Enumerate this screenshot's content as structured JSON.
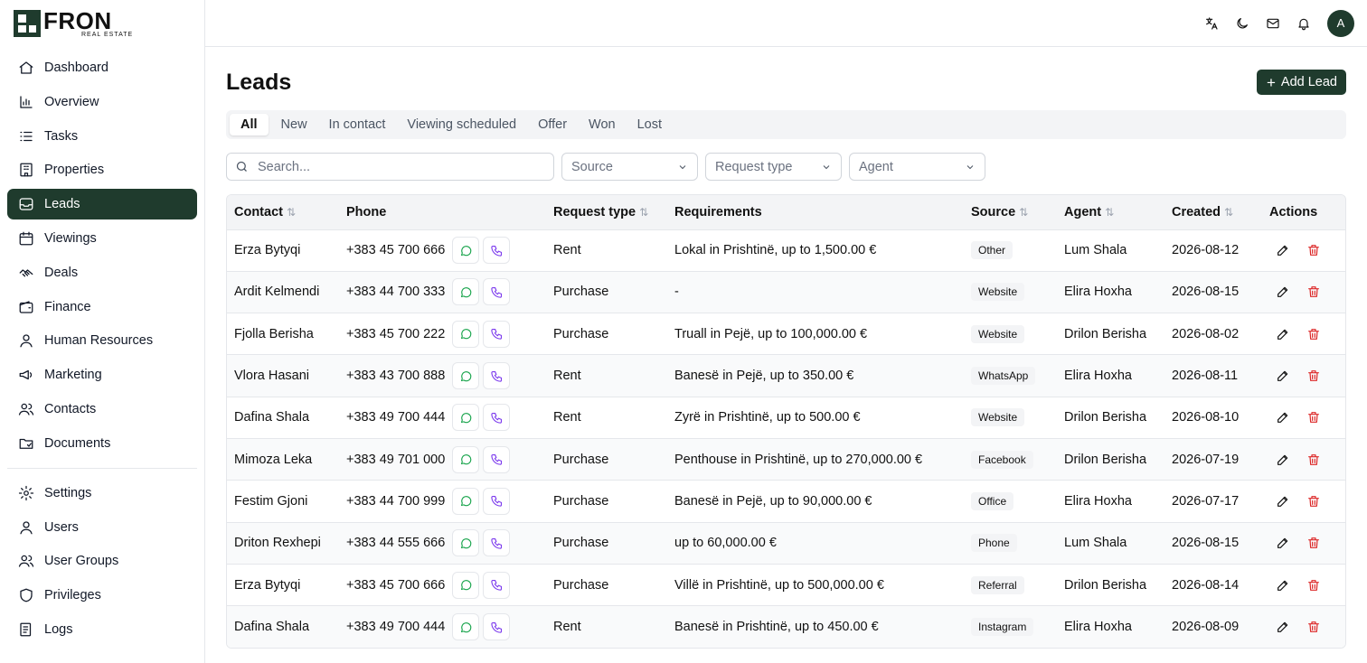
{
  "brand": {
    "name": "FRON",
    "tagline": "REAL ESTATE"
  },
  "sidebar": {
    "items": [
      {
        "label": "Dashboard",
        "icon": "home-icon"
      },
      {
        "label": "Overview",
        "icon": "chart-icon"
      },
      {
        "label": "Tasks",
        "icon": "list-icon"
      },
      {
        "label": "Properties",
        "icon": "building-icon"
      },
      {
        "label": "Leads",
        "icon": "inbox-icon",
        "active": true
      },
      {
        "label": "Viewings",
        "icon": "calendar-icon"
      },
      {
        "label": "Deals",
        "icon": "handshake-icon"
      },
      {
        "label": "Finance",
        "icon": "wallet-icon"
      },
      {
        "label": "Human Resources",
        "icon": "user-icon"
      },
      {
        "label": "Marketing",
        "icon": "megaphone-icon"
      },
      {
        "label": "Contacts",
        "icon": "users-icon"
      },
      {
        "label": "Documents",
        "icon": "folder-icon"
      }
    ],
    "bottom_items": [
      {
        "label": "Settings",
        "icon": "gear-icon"
      },
      {
        "label": "Users",
        "icon": "user-icon"
      },
      {
        "label": "User Groups",
        "icon": "users-icon"
      },
      {
        "label": "Privileges",
        "icon": "shield-icon"
      },
      {
        "label": "Logs",
        "icon": "logs-icon"
      }
    ]
  },
  "topbar": {
    "avatar_initial": "A"
  },
  "page": {
    "title": "Leads",
    "add_button": "Add Lead"
  },
  "tabs": [
    {
      "label": "All",
      "active": true
    },
    {
      "label": "New"
    },
    {
      "label": "In contact"
    },
    {
      "label": "Viewing scheduled"
    },
    {
      "label": "Offer"
    },
    {
      "label": "Won"
    },
    {
      "label": "Lost"
    }
  ],
  "filters": {
    "search_placeholder": "Search...",
    "source": "Source",
    "request_type": "Request type",
    "agent": "Agent"
  },
  "table": {
    "columns": {
      "contact": "Contact",
      "phone": "Phone",
      "request_type": "Request type",
      "requirements": "Requirements",
      "source": "Source",
      "agent": "Agent",
      "created": "Created",
      "actions": "Actions"
    },
    "rows": [
      {
        "contact": "Erza Bytyqi",
        "phone": "+383 45 700 666",
        "request_type": "Rent",
        "requirements": "Lokal in Prishtinë, up to 1,500.00 €",
        "source": "Other",
        "agent": "Lum Shala",
        "created": "2026-08-12"
      },
      {
        "contact": "Ardit Kelmendi",
        "phone": "+383 44 700 333",
        "request_type": "Purchase",
        "requirements": "-",
        "source": "Website",
        "agent": "Elira Hoxha",
        "created": "2026-08-15"
      },
      {
        "contact": "Fjolla Berisha",
        "phone": "+383 45 700 222",
        "request_type": "Purchase",
        "requirements": "Truall in Pejë, up to 100,000.00 €",
        "source": "Website",
        "agent": "Drilon Berisha",
        "created": "2026-08-02"
      },
      {
        "contact": "Vlora Hasani",
        "phone": "+383 43 700 888",
        "request_type": "Rent",
        "requirements": "Banesë in Pejë, up to 350.00 €",
        "source": "WhatsApp",
        "agent": "Elira Hoxha",
        "created": "2026-08-11"
      },
      {
        "contact": "Dafina Shala",
        "phone": "+383 49 700 444",
        "request_type": "Rent",
        "requirements": "Zyrë in Prishtinë, up to 500.00 €",
        "source": "Website",
        "agent": "Drilon Berisha",
        "created": "2026-08-10"
      },
      {
        "contact": "Mimoza Leka",
        "phone": "+383 49 701 000",
        "request_type": "Purchase",
        "requirements": "Penthouse in Prishtinë, up to 270,000.00 €",
        "source": "Facebook",
        "agent": "Drilon Berisha",
        "created": "2026-07-19"
      },
      {
        "contact": "Festim Gjoni",
        "phone": "+383 44 700 999",
        "request_type": "Purchase",
        "requirements": "Banesë in Pejë, up to 90,000.00 €",
        "source": "Office",
        "agent": "Elira Hoxha",
        "created": "2026-07-17"
      },
      {
        "contact": "Driton Rexhepi",
        "phone": "+383 44 555 666",
        "request_type": "Purchase",
        "requirements": "up to 60,000.00 €",
        "source": "Phone",
        "agent": "Lum Shala",
        "created": "2026-08-15"
      },
      {
        "contact": "Erza Bytyqi",
        "phone": "+383 45 700 666",
        "request_type": "Purchase",
        "requirements": "Villë in Prishtinë, up to 500,000.00 €",
        "source": "Referral",
        "agent": "Drilon Berisha",
        "created": "2026-08-14"
      },
      {
        "contact": "Dafina Shala",
        "phone": "+383 49 700 444",
        "request_type": "Rent",
        "requirements": "Banesë in Prishtinë, up to 450.00 €",
        "source": "Instagram",
        "agent": "Elira Hoxha",
        "created": "2026-08-09"
      }
    ]
  }
}
